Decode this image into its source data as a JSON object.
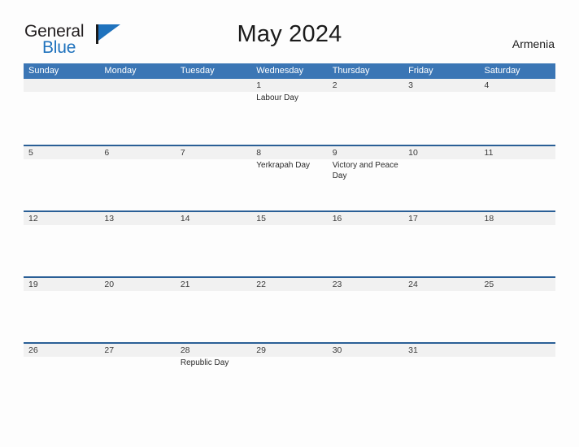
{
  "brand": {
    "name_part1": "General",
    "name_part2": "Blue",
    "flag_icon": "blue-flag-triangle-logo",
    "accent_color": "#1f72bd"
  },
  "header": {
    "title": "May 2024",
    "location": "Armenia"
  },
  "theme": {
    "header_blue": "#3b76b5",
    "row_divider_blue": "#2a5f96",
    "daynum_band_gray": "#f1f1f1",
    "page_background": "#fdfdfd",
    "text_dark": "#1b1b1b"
  },
  "calendar": {
    "month": "May",
    "year": "2024",
    "weekday_headers": [
      "Sunday",
      "Monday",
      "Tuesday",
      "Wednesday",
      "Thursday",
      "Friday",
      "Saturday"
    ],
    "weeks": [
      [
        {
          "num": "",
          "events": []
        },
        {
          "num": "",
          "events": []
        },
        {
          "num": "",
          "events": []
        },
        {
          "num": "1",
          "events": [
            "Labour Day"
          ]
        },
        {
          "num": "2",
          "events": []
        },
        {
          "num": "3",
          "events": []
        },
        {
          "num": "4",
          "events": []
        }
      ],
      [
        {
          "num": "5",
          "events": []
        },
        {
          "num": "6",
          "events": []
        },
        {
          "num": "7",
          "events": []
        },
        {
          "num": "8",
          "events": [
            "Yerkrapah Day"
          ]
        },
        {
          "num": "9",
          "events": [
            "Victory and Peace Day"
          ]
        },
        {
          "num": "10",
          "events": []
        },
        {
          "num": "11",
          "events": []
        }
      ],
      [
        {
          "num": "12",
          "events": []
        },
        {
          "num": "13",
          "events": []
        },
        {
          "num": "14",
          "events": []
        },
        {
          "num": "15",
          "events": []
        },
        {
          "num": "16",
          "events": []
        },
        {
          "num": "17",
          "events": []
        },
        {
          "num": "18",
          "events": []
        }
      ],
      [
        {
          "num": "19",
          "events": []
        },
        {
          "num": "20",
          "events": []
        },
        {
          "num": "21",
          "events": []
        },
        {
          "num": "22",
          "events": []
        },
        {
          "num": "23",
          "events": []
        },
        {
          "num": "24",
          "events": []
        },
        {
          "num": "25",
          "events": []
        }
      ],
      [
        {
          "num": "26",
          "events": []
        },
        {
          "num": "27",
          "events": []
        },
        {
          "num": "28",
          "events": [
            "Republic Day"
          ]
        },
        {
          "num": "29",
          "events": []
        },
        {
          "num": "30",
          "events": []
        },
        {
          "num": "31",
          "events": []
        },
        {
          "num": "",
          "events": []
        }
      ]
    ]
  }
}
